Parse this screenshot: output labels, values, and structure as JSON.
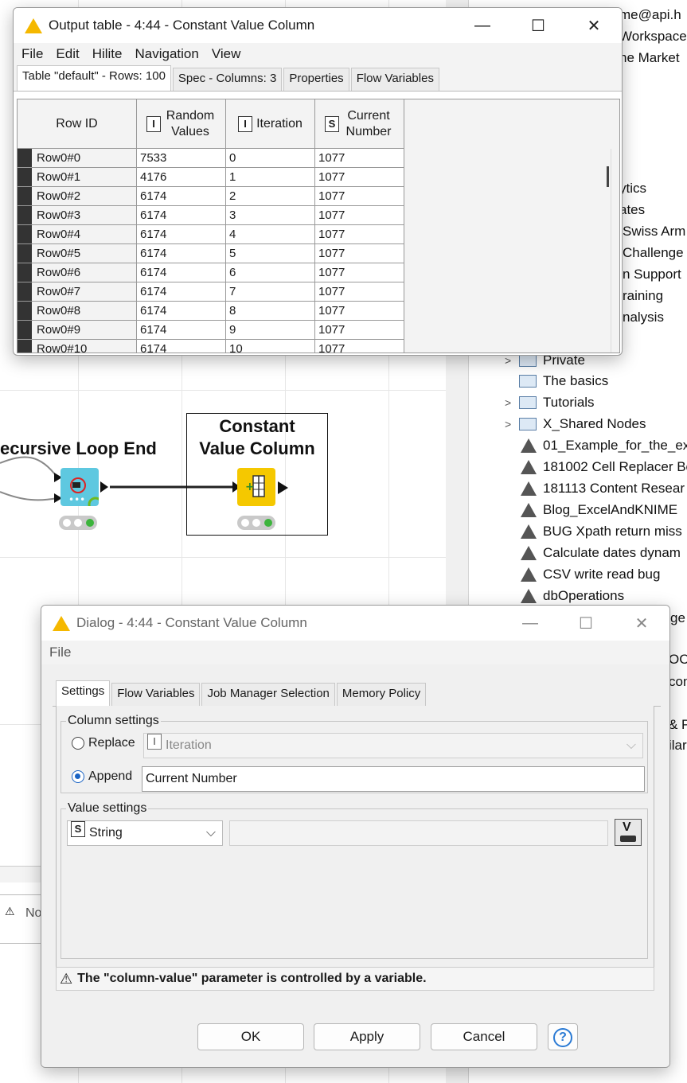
{
  "output_window": {
    "title": "Output table - 4:44 - Constant Value Column",
    "menu": [
      "File",
      "Edit",
      "Hilite",
      "Navigation",
      "View"
    ],
    "tabs": [
      "Table \"default\" - Rows: 100",
      "Spec - Columns: 3",
      "Properties",
      "Flow Variables"
    ],
    "columns": [
      {
        "label": "Row ID",
        "type": ""
      },
      {
        "label": "Random Values",
        "type": "I"
      },
      {
        "label": "Iteration",
        "type": "I"
      },
      {
        "label": "Current Number",
        "type": "S"
      }
    ],
    "rows": [
      [
        "Row0#0",
        "7533",
        "0",
        "1077"
      ],
      [
        "Row0#1",
        "4176",
        "1",
        "1077"
      ],
      [
        "Row0#2",
        "6174",
        "2",
        "1077"
      ],
      [
        "Row0#3",
        "6174",
        "3",
        "1077"
      ],
      [
        "Row0#4",
        "6174",
        "4",
        "1077"
      ],
      [
        "Row0#5",
        "6174",
        "5",
        "1077"
      ],
      [
        "Row0#6",
        "6174",
        "6",
        "1077"
      ],
      [
        "Row0#7",
        "6174",
        "7",
        "1077"
      ],
      [
        "Row0#8",
        "6174",
        "8",
        "1077"
      ],
      [
        "Row0#9",
        "6174",
        "9",
        "1077"
      ],
      [
        "Row0#10",
        "6174",
        "10",
        "1077"
      ]
    ]
  },
  "workflow": {
    "loop_end_label": "ecursive Loop End",
    "constant_label_line1": "Constant",
    "constant_label_line2": "Value Column"
  },
  "explorer": {
    "top_fragments": [
      "me@api.h",
      "Workspace)",
      "ne Market"
    ],
    "mid_fragments": [
      "ytics",
      "ates",
      "Swiss Arm",
      "Challenge",
      "n Support",
      "raining",
      "nalysis"
    ],
    "folders": [
      "Private",
      "The basics",
      "Tutorials",
      "X_Shared Nodes"
    ],
    "workflows": [
      "01_Example_for_the_ex",
      "181002 Cell Replacer Bo",
      "181113 Content Resear",
      "Blog_ExcelAndKNIME",
      "BUG Xpath return miss",
      "Calculate dates dynam",
      "CSV write read bug",
      "dbOperations"
    ],
    "lower_fragments": [
      "ge",
      "OCF",
      "con",
      "& P",
      "ilar"
    ],
    "bottom_left_tab": "No"
  },
  "dialog": {
    "title": "Dialog - 4:44 - Constant Value Column",
    "menu": [
      "File"
    ],
    "tabs": [
      "Settings",
      "Flow Variables",
      "Job Manager Selection",
      "Memory Policy"
    ],
    "column_settings_legend": "Column settings",
    "replace_label": "Replace",
    "replace_column": "Iteration",
    "replace_type": "I",
    "append_label": "Append",
    "append_value": "Current Number",
    "value_settings_legend": "Value settings",
    "value_type_badge": "S",
    "value_type": "String",
    "value_field": "",
    "variable_button": "V",
    "warning": "The \"column-value\" parameter is controlled by a variable.",
    "ok_label": "OK",
    "apply_label": "Apply",
    "cancel_label": "Cancel",
    "help_label": "?"
  }
}
